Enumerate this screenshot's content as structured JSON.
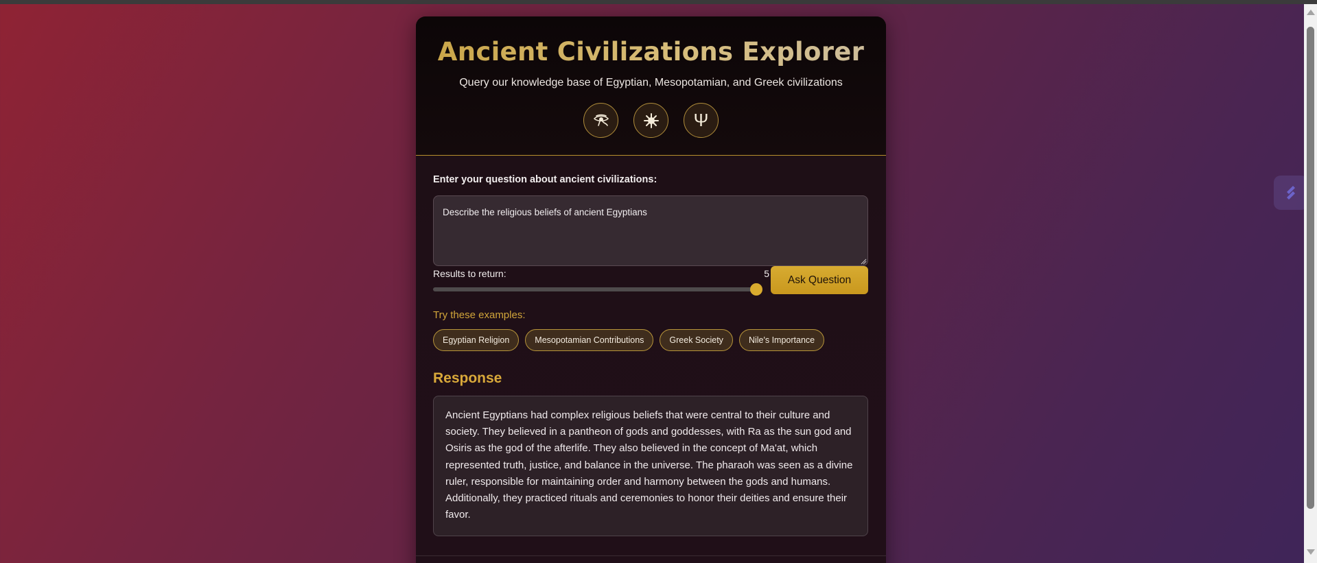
{
  "header": {
    "title": "Ancient Civilizations Explorer",
    "subtitle": "Query our knowledge base of Egyptian, Mesopotamian, and Greek civilizations",
    "icons": [
      {
        "name": "eye-of-horus-icon"
      },
      {
        "name": "sun-star-icon"
      },
      {
        "name": "psi-trident-icon",
        "glyph": "Ψ"
      }
    ]
  },
  "query": {
    "label": "Enter your question about ancient civilizations:",
    "value": "Describe the religious beliefs of ancient Egyptians"
  },
  "results": {
    "label": "Results to return:",
    "value": "5",
    "level_fraction": 1.0
  },
  "ask_button": "Ask Question",
  "examples": {
    "label": "Try these examples:",
    "items": [
      "Egyptian Religion",
      "Mesopotamian Contributions",
      "Greek Society",
      "Nile's Importance"
    ]
  },
  "response": {
    "title": "Response",
    "text": "Ancient Egyptians had complex religious beliefs that were central to their culture and society. They believed in a pantheon of gods and goddesses, with Ra as the sun god and Osiris as the god of the afterlife. They also believed in the concept of Ma'at, which represented truth, justice, and balance in the universe. The pharaoh was seen as a divine ruler, responsible for maintaining order and harmony between the gods and humans. Additionally, they practiced rituals and ceremonies to honor their deities and ensure their favor."
  },
  "colors": {
    "accent_gold": "#d9ab2e",
    "background_start": "#8f2334",
    "background_end": "#3f2559",
    "card_bg": "#1f0f17"
  }
}
